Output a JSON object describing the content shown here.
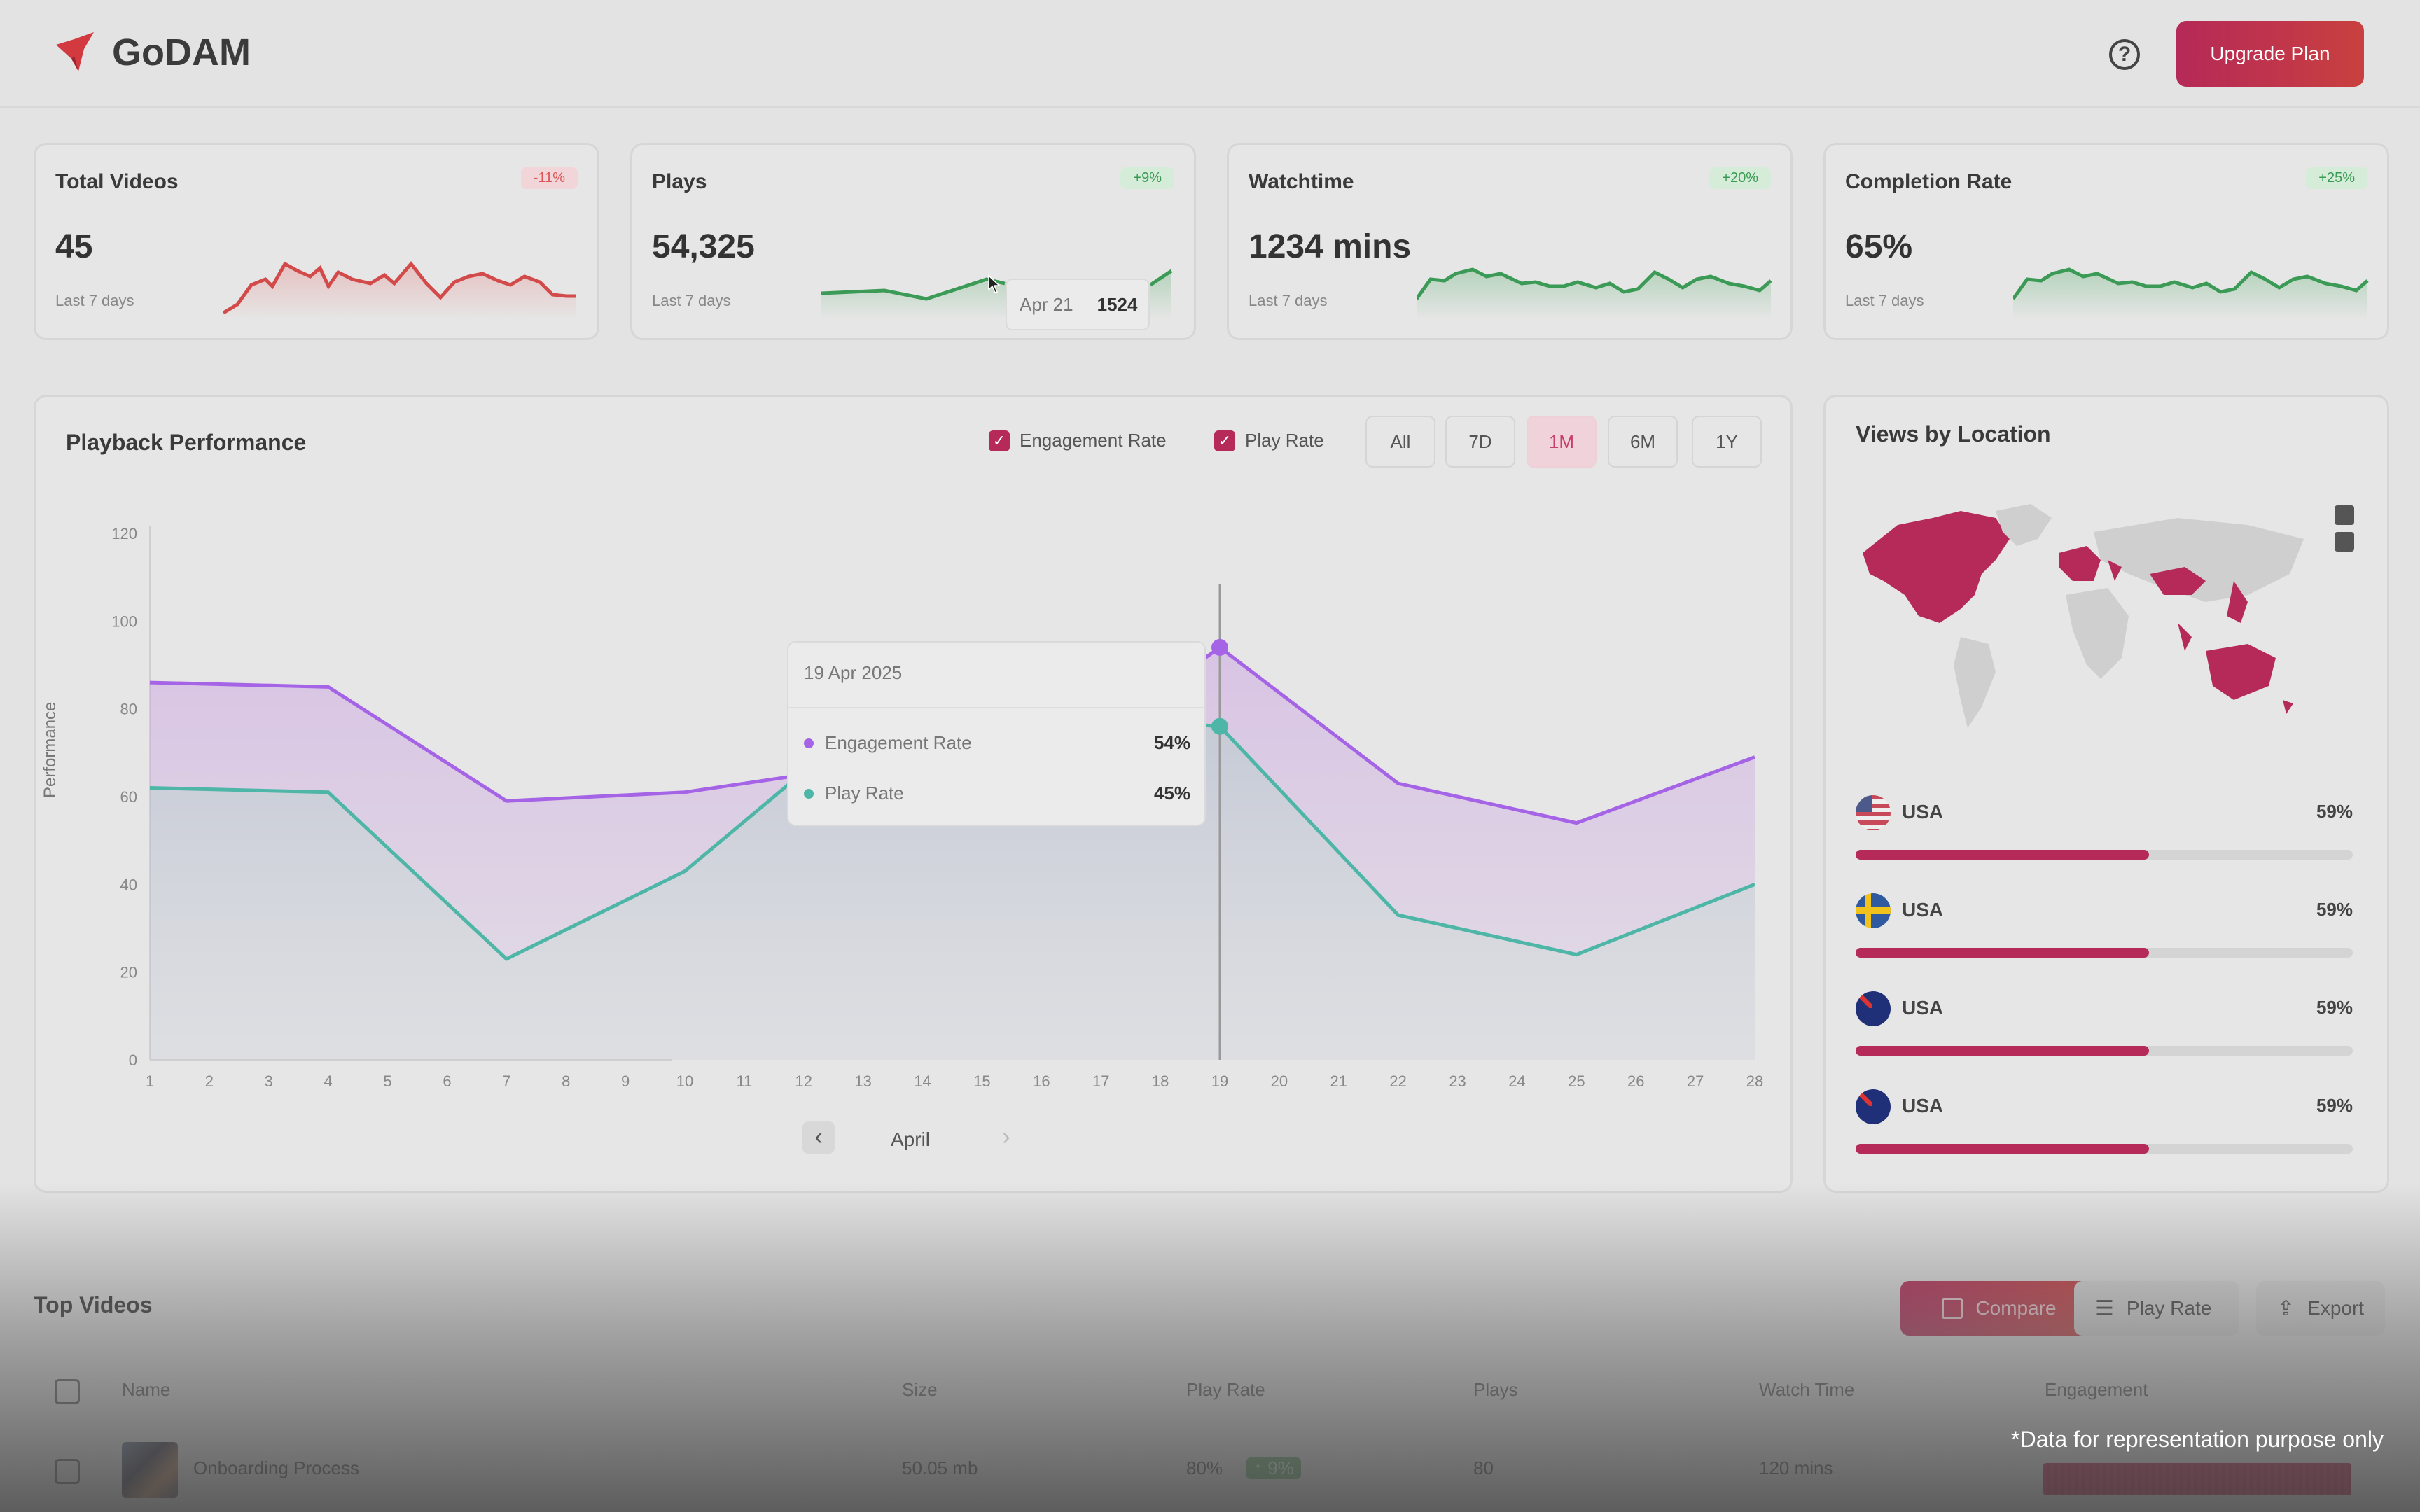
{
  "app": {
    "name": "GoDAM"
  },
  "header": {
    "help_icon": "help-circle-icon",
    "upgrade_label": "Upgrade Plan"
  },
  "kpis": [
    {
      "title": "Total Videos",
      "value": "45",
      "sub": "Last 7 days",
      "badge": "-11%",
      "trend": "negative"
    },
    {
      "title": "Plays",
      "value": "54,325",
      "sub": "Last 7 days",
      "badge": "+9%",
      "trend": "positive"
    },
    {
      "title": "Watchtime",
      "value": "1234 mins",
      "sub": "Last 7 days",
      "badge": "+20%",
      "trend": "positive"
    },
    {
      "title": "Completion Rate",
      "value": "65%",
      "sub": "Last 7 days",
      "badge": "+25%",
      "trend": "positive"
    }
  ],
  "plays_tooltip": {
    "date": "Apr 21",
    "value": "1524"
  },
  "playback": {
    "title": "Playback Performance",
    "legend": [
      "Engagement Rate",
      "Play Rate"
    ],
    "ranges": [
      "All",
      "7D",
      "1M",
      "6M",
      "1Y"
    ],
    "active_range": "1M",
    "month": "April",
    "tooltip": {
      "date": "19 Apr 2025",
      "rows": [
        {
          "label": "Engagement Rate",
          "value": "54%"
        },
        {
          "label": "Play Rate",
          "value": "45%"
        }
      ]
    }
  },
  "chart_data": {
    "type": "area",
    "ylabel": "Performance",
    "ylim": [
      0,
      120
    ],
    "yticks": [
      0,
      20,
      40,
      60,
      80,
      100,
      120
    ],
    "x": [
      1,
      2,
      3,
      4,
      5,
      6,
      7,
      8,
      9,
      10,
      11,
      12,
      13,
      14,
      15,
      16,
      17,
      18,
      19,
      20,
      21,
      22,
      23,
      24,
      25,
      26,
      27,
      28
    ],
    "series": [
      {
        "name": "Engagement Rate",
        "color": "#a564e6",
        "points": [
          [
            1,
            86
          ],
          [
            4,
            85
          ],
          [
            7,
            59
          ],
          [
            10,
            61
          ],
          [
            13,
            67
          ],
          [
            16,
            65
          ],
          [
            19,
            94
          ],
          [
            22,
            63
          ],
          [
            25,
            54
          ],
          [
            28,
            69
          ]
        ]
      },
      {
        "name": "Play Rate",
        "color": "#4db6a6",
        "points": [
          [
            1,
            62
          ],
          [
            4,
            61
          ],
          [
            7,
            23
          ],
          [
            10,
            43
          ],
          [
            13,
            77
          ],
          [
            16,
            79
          ],
          [
            19,
            76
          ],
          [
            22,
            33
          ],
          [
            25,
            24
          ],
          [
            28,
            40
          ]
        ]
      }
    ],
    "highlight_x": 19
  },
  "location": {
    "title": "Views by Location",
    "rows": [
      {
        "name": "USA",
        "pct": "59%",
        "value": 0.59,
        "flag": "us-flag"
      },
      {
        "name": "USA",
        "pct": "59%",
        "value": 0.59,
        "flag": "se-flag"
      },
      {
        "name": "USA",
        "pct": "59%",
        "value": 0.59,
        "flag": "au-flag"
      },
      {
        "name": "USA",
        "pct": "59%",
        "value": 0.59,
        "flag": "au-flag"
      }
    ]
  },
  "top_videos": {
    "title": "Top Videos",
    "compare_label": "Compare",
    "filter_label": "Play Rate",
    "export_label": "Export",
    "columns": [
      "Name",
      "Size",
      "Play Rate",
      "Plays",
      "Watch Time",
      "Engagement"
    ],
    "rows": [
      {
        "name": "Onboarding Process",
        "size": "50.05 mb",
        "play_rate": "80%",
        "delta": "↑ 9%",
        "plays": "80",
        "watch_time": "120 mins"
      }
    ]
  },
  "footnote": "*Data for representation purpose only"
}
